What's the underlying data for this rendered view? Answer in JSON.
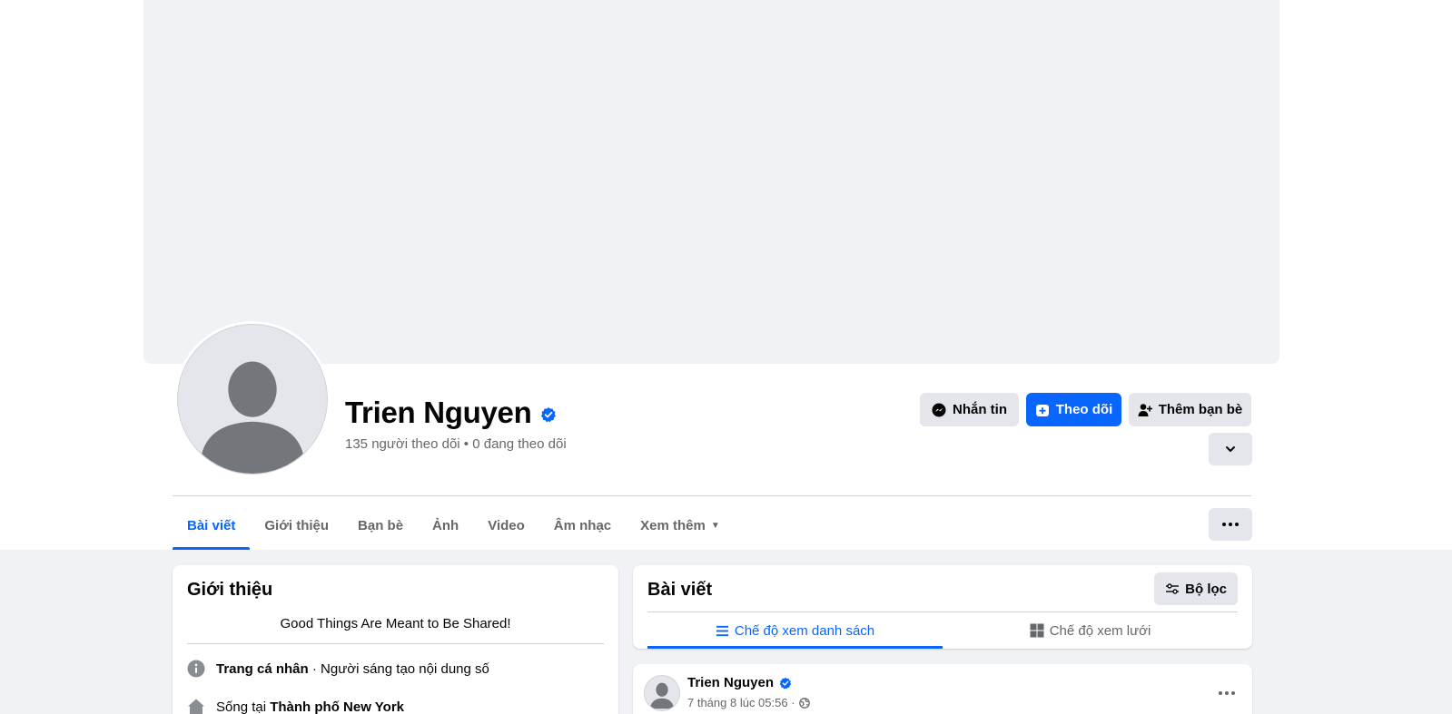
{
  "profile": {
    "name": "Trien Nguyen",
    "stats": "135 người theo dõi • 0 đang theo dõi",
    "verified_color": "#0866ff"
  },
  "actions": {
    "message_label": "Nhắn tin",
    "follow_label": "Theo dõi",
    "add_friend_label": "Thêm bạn bè"
  },
  "tabs": [
    {
      "label": "Bài viết",
      "active": true
    },
    {
      "label": "Giới thiệu"
    },
    {
      "label": "Bạn bè"
    },
    {
      "label": "Ảnh"
    },
    {
      "label": "Video"
    },
    {
      "label": "Âm nhạc"
    },
    {
      "label": "Xem thêm"
    }
  ],
  "intro": {
    "title": "Giới thiệu",
    "bio": "Good Things Are Meant to Be Shared!",
    "profile_type_label": "Trang cá nhân",
    "profile_type_value": " · Người sáng tạo nội dung số",
    "lives_in_label": "Sống tại ",
    "lives_in_value": "Thành phố New York"
  },
  "posts": {
    "title": "Bài viết",
    "filter_label": "Bộ lọc",
    "list_view_label": "Chế độ xem danh sách",
    "grid_view_label": "Chế độ xem lưới"
  },
  "post": {
    "author": "Trien Nguyen",
    "time": "7 tháng 8 lúc 05:56 ·"
  },
  "colors": {
    "accent": "#0866ff",
    "button_gray": "#e4e6eb",
    "page_bg": "#f0f2f5"
  }
}
